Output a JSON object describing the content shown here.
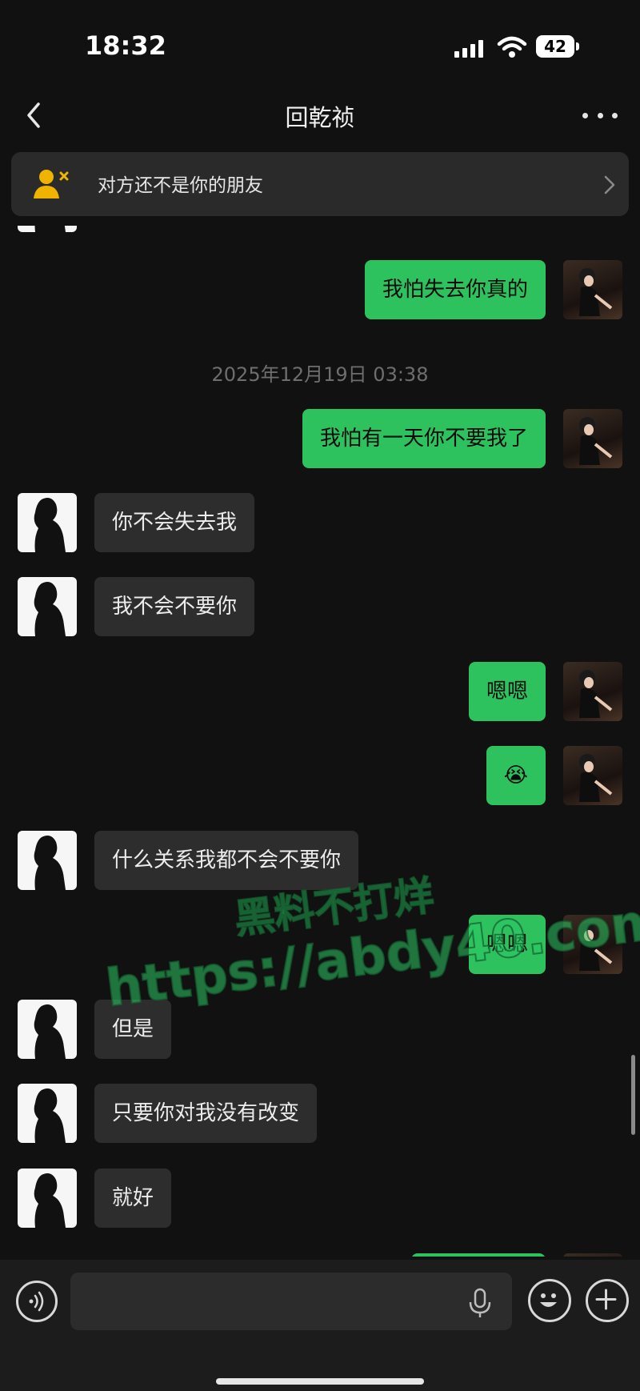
{
  "status_bar": {
    "time": "18:32",
    "battery": "42"
  },
  "header": {
    "title": "回乾祯",
    "back_icon": "chevron-left-icon",
    "more_icon": "more-icon"
  },
  "banner": {
    "text": "对方还不是你的朋友",
    "icon": "user-not-friend-icon",
    "accent": "#f0b400"
  },
  "messages": [
    {
      "side": "out",
      "text": "我怕失去你真的"
    },
    {
      "type": "timestamp",
      "text": "2025年12月19日 03:38"
    },
    {
      "side": "out",
      "text": "我怕有一天你不要我了"
    },
    {
      "side": "in",
      "text": "你不会失去我"
    },
    {
      "side": "in",
      "text": "我不会不要你"
    },
    {
      "side": "out",
      "text": "嗯嗯"
    },
    {
      "side": "out",
      "text": "😭"
    },
    {
      "side": "in",
      "text": "什么关系我都不会不要你"
    },
    {
      "side": "out",
      "text": "嗯嗯"
    },
    {
      "side": "in",
      "text": "但是"
    },
    {
      "side": "in",
      "text": "只要你对我没有改变"
    },
    {
      "side": "in",
      "text": "就好"
    }
  ],
  "watermark": {
    "line1": "黑料不打烊",
    "line2": "https://abdy40.com"
  },
  "input_bar": {
    "voice_icon": "voice-icon",
    "mic_icon": "mic-icon",
    "emoji_icon": "emoji-icon",
    "plus_icon": "plus-icon"
  },
  "colors": {
    "sent_bubble": "#2dc25e",
    "received_bubble": "#2d2d2d",
    "background": "#111111"
  }
}
